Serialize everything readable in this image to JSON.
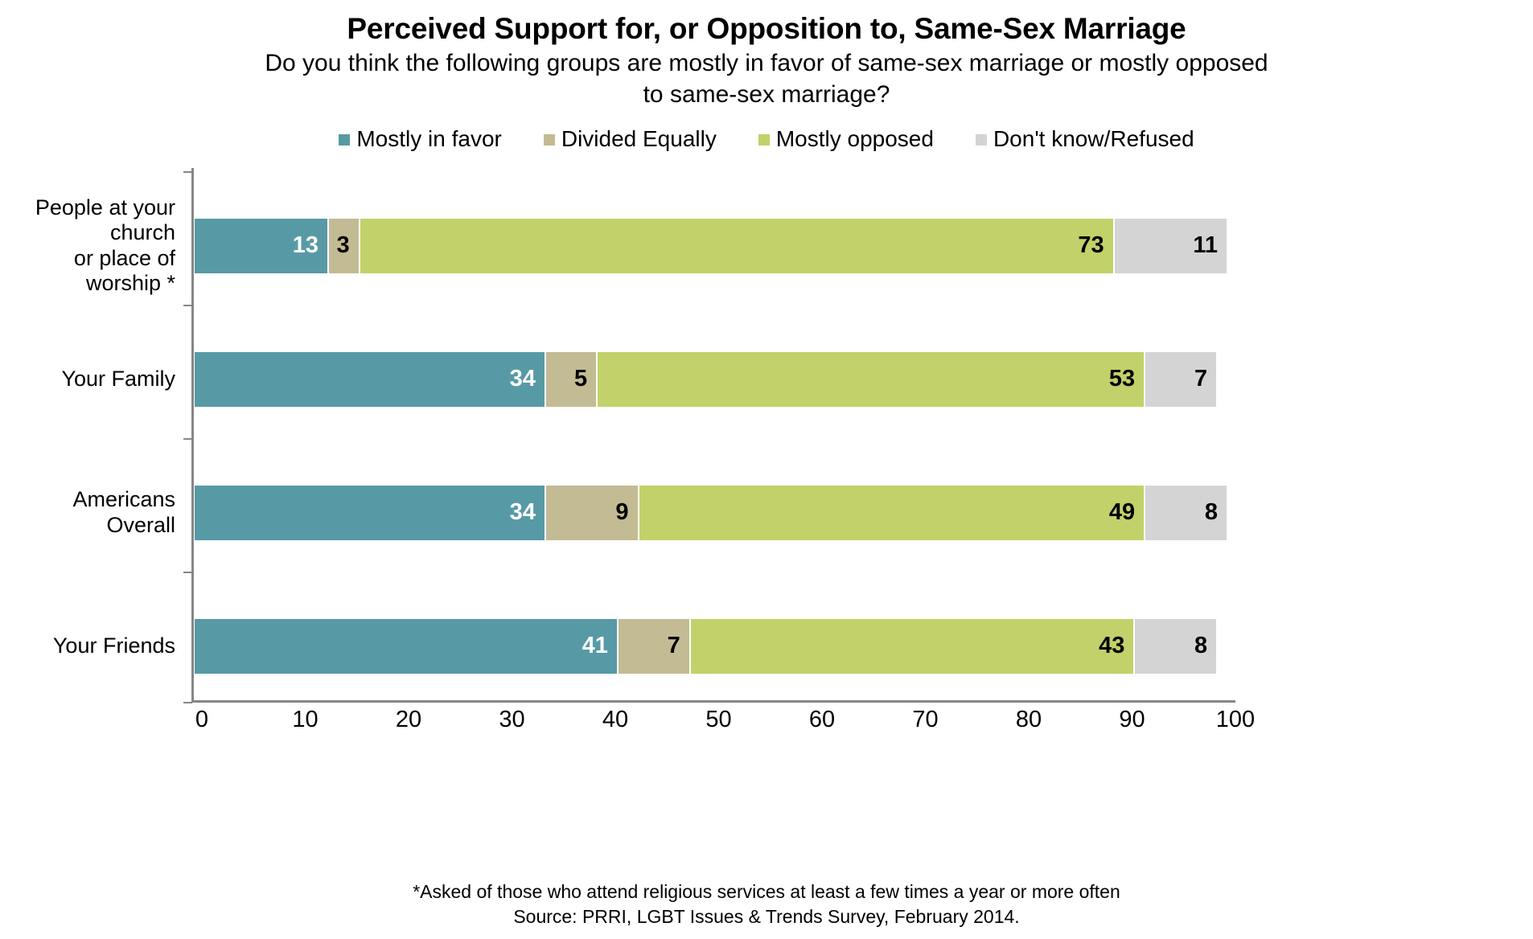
{
  "header": {
    "title": "Perceived Support for, or Opposition to, Same-Sex Marriage",
    "subtitle_line1": "Do you think the following groups are mostly in favor of same-sex marriage or mostly opposed",
    "subtitle_line2": "to same-sex marriage?"
  },
  "legend": {
    "items": [
      {
        "label": "Mostly in favor",
        "color": "#579aa5"
      },
      {
        "label": "Divided Equally",
        "color": "#c3bb94"
      },
      {
        "label": "Mostly opposed",
        "color": "#c2d169"
      },
      {
        "label": "Don't know/Refused",
        "color": "#d4d4d4"
      }
    ]
  },
  "footnotes": {
    "line1": "*Asked of those who attend religious services at least a few times a year or more often",
    "line2": "Source: PRRI, LGBT Issues & Trends Survey, February 2014."
  },
  "chart_data": {
    "type": "bar",
    "orientation": "horizontal",
    "stacked": true,
    "title": "Perceived Support for, or Opposition to, Same-Sex Marriage",
    "subtitle": "Do you think the following groups are mostly in favor of same-sex marriage or mostly opposed to same-sex marriage?",
    "xlabel": "",
    "ylabel": "",
    "xlim": [
      0,
      100
    ],
    "xticks": [
      0,
      10,
      20,
      30,
      40,
      50,
      60,
      70,
      80,
      90,
      100
    ],
    "grid": false,
    "legend_position": "top",
    "categories": [
      "People at your church\nor place of worship *",
      "Your Family",
      "Americans Overall",
      "Your Friends"
    ],
    "series": [
      {
        "name": "Mostly in favor",
        "color": "#579aa5",
        "values": [
          13,
          34,
          34,
          41
        ]
      },
      {
        "name": "Divided Equally",
        "color": "#c3bb94",
        "values": [
          3,
          5,
          9,
          7
        ]
      },
      {
        "name": "Mostly opposed",
        "color": "#c2d169",
        "values": [
          73,
          53,
          49,
          43
        ]
      },
      {
        "name": "Don't know/Refused",
        "color": "#d4d4d4",
        "values": [
          11,
          7,
          8,
          8
        ]
      }
    ],
    "rows": [
      {
        "label_line1": "People at your church",
        "label_line2": "or place of worship *",
        "segments": [
          {
            "name": "Mostly in favor",
            "value": 13,
            "color": "#579aa5",
            "text_color": "light"
          },
          {
            "name": "Divided Equally",
            "value": 3,
            "color": "#c3bb94",
            "text_color": "dark"
          },
          {
            "name": "Mostly opposed",
            "value": 73,
            "color": "#c2d169",
            "text_color": "dark"
          },
          {
            "name": "Don't know/Refused",
            "value": 11,
            "color": "#d4d4d4",
            "text_color": "dark"
          }
        ]
      },
      {
        "label_line1": "Your Family",
        "label_line2": "",
        "segments": [
          {
            "name": "Mostly in favor",
            "value": 34,
            "color": "#579aa5",
            "text_color": "light"
          },
          {
            "name": "Divided Equally",
            "value": 5,
            "color": "#c3bb94",
            "text_color": "dark"
          },
          {
            "name": "Mostly opposed",
            "value": 53,
            "color": "#c2d169",
            "text_color": "dark"
          },
          {
            "name": "Don't know/Refused",
            "value": 7,
            "color": "#d4d4d4",
            "text_color": "dark"
          }
        ]
      },
      {
        "label_line1": "Americans Overall",
        "label_line2": "",
        "segments": [
          {
            "name": "Mostly in favor",
            "value": 34,
            "color": "#579aa5",
            "text_color": "light"
          },
          {
            "name": "Divided Equally",
            "value": 9,
            "color": "#c3bb94",
            "text_color": "dark"
          },
          {
            "name": "Mostly opposed",
            "value": 49,
            "color": "#c2d169",
            "text_color": "dark"
          },
          {
            "name": "Don't know/Refused",
            "value": 8,
            "color": "#d4d4d4",
            "text_color": "dark"
          }
        ]
      },
      {
        "label_line1": "Your Friends",
        "label_line2": "",
        "segments": [
          {
            "name": "Mostly in favor",
            "value": 41,
            "color": "#579aa5",
            "text_color": "light"
          },
          {
            "name": "Divided Equally",
            "value": 7,
            "color": "#c3bb94",
            "text_color": "dark"
          },
          {
            "name": "Mostly opposed",
            "value": 43,
            "color": "#c2d169",
            "text_color": "dark"
          },
          {
            "name": "Don't know/Refused",
            "value": 8,
            "color": "#d4d4d4",
            "text_color": "dark"
          }
        ]
      }
    ]
  }
}
